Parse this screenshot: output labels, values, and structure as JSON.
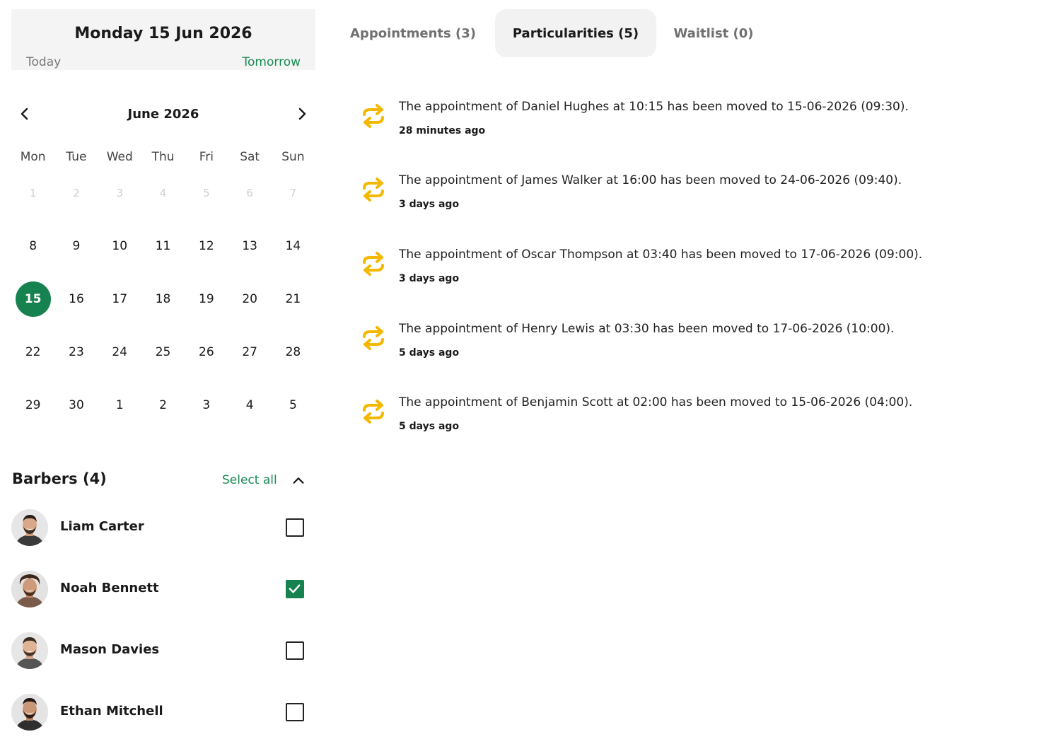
{
  "date_header": {
    "title": "Monday 15 Jun 2026",
    "today_label": "Today",
    "tomorrow_label": "Tomorrow"
  },
  "calendar": {
    "month_label": "June 2026",
    "prev_icon": "chevron-left-icon",
    "next_icon": "chevron-right-icon",
    "weekdays": [
      "Mon",
      "Tue",
      "Wed",
      "Thu",
      "Fri",
      "Sat",
      "Sun"
    ],
    "days": [
      {
        "label": "1",
        "muted": true
      },
      {
        "label": "2",
        "muted": true
      },
      {
        "label": "3",
        "muted": true
      },
      {
        "label": "4",
        "muted": true
      },
      {
        "label": "5",
        "muted": true
      },
      {
        "label": "6",
        "muted": true
      },
      {
        "label": "7",
        "muted": true
      },
      {
        "label": "8"
      },
      {
        "label": "9"
      },
      {
        "label": "10"
      },
      {
        "label": "11"
      },
      {
        "label": "12"
      },
      {
        "label": "13"
      },
      {
        "label": "14"
      },
      {
        "label": "15",
        "selected": true
      },
      {
        "label": "16"
      },
      {
        "label": "17"
      },
      {
        "label": "18"
      },
      {
        "label": "19"
      },
      {
        "label": "20"
      },
      {
        "label": "21"
      },
      {
        "label": "22"
      },
      {
        "label": "23"
      },
      {
        "label": "24"
      },
      {
        "label": "25"
      },
      {
        "label": "26"
      },
      {
        "label": "27"
      },
      {
        "label": "28"
      },
      {
        "label": "29"
      },
      {
        "label": "30"
      },
      {
        "label": "1"
      },
      {
        "label": "2"
      },
      {
        "label": "3"
      },
      {
        "label": "4"
      },
      {
        "label": "5"
      }
    ]
  },
  "barbers": {
    "title": "Barbers (4)",
    "select_all_label": "Select all",
    "list": [
      {
        "name": "Liam Carter",
        "checked": false
      },
      {
        "name": "Noah Bennett",
        "checked": true
      },
      {
        "name": "Mason Davies",
        "checked": false
      },
      {
        "name": "Ethan Mitchell",
        "checked": false
      }
    ]
  },
  "tabs": [
    {
      "label": "Appointments (3)",
      "active": false
    },
    {
      "label": "Particularities (5)",
      "active": true
    },
    {
      "label": "Waitlist (0)",
      "active": false
    }
  ],
  "notifications": [
    {
      "icon": "swap-arrows-icon",
      "text": "The appointment of Daniel Hughes at 10:15 has been moved to 15-06-2026 (09:30).",
      "time": "28 minutes ago"
    },
    {
      "icon": "swap-arrows-icon",
      "text": "The appointment of James Walker at 16:00 has been moved to 24-06-2026 (09:40).",
      "time": "3 days ago"
    },
    {
      "icon": "swap-arrows-icon",
      "text": "The appointment of Oscar Thompson at 03:40 has been moved to 17-06-2026 (09:00).",
      "time": "3 days ago"
    },
    {
      "icon": "swap-arrows-icon",
      "text": "The appointment of Henry Lewis at 03:30 has been moved to 17-06-2026 (10:00).",
      "time": "5 days ago"
    },
    {
      "icon": "swap-arrows-icon",
      "text": "The appointment of Benjamin Scott at 02:00 has been moved to 15-06-2026 (04:00).",
      "time": "5 days ago"
    }
  ],
  "colors": {
    "accent_green": "#16824f",
    "link_green": "#1a8a52",
    "notification_icon": "#f5b800"
  }
}
